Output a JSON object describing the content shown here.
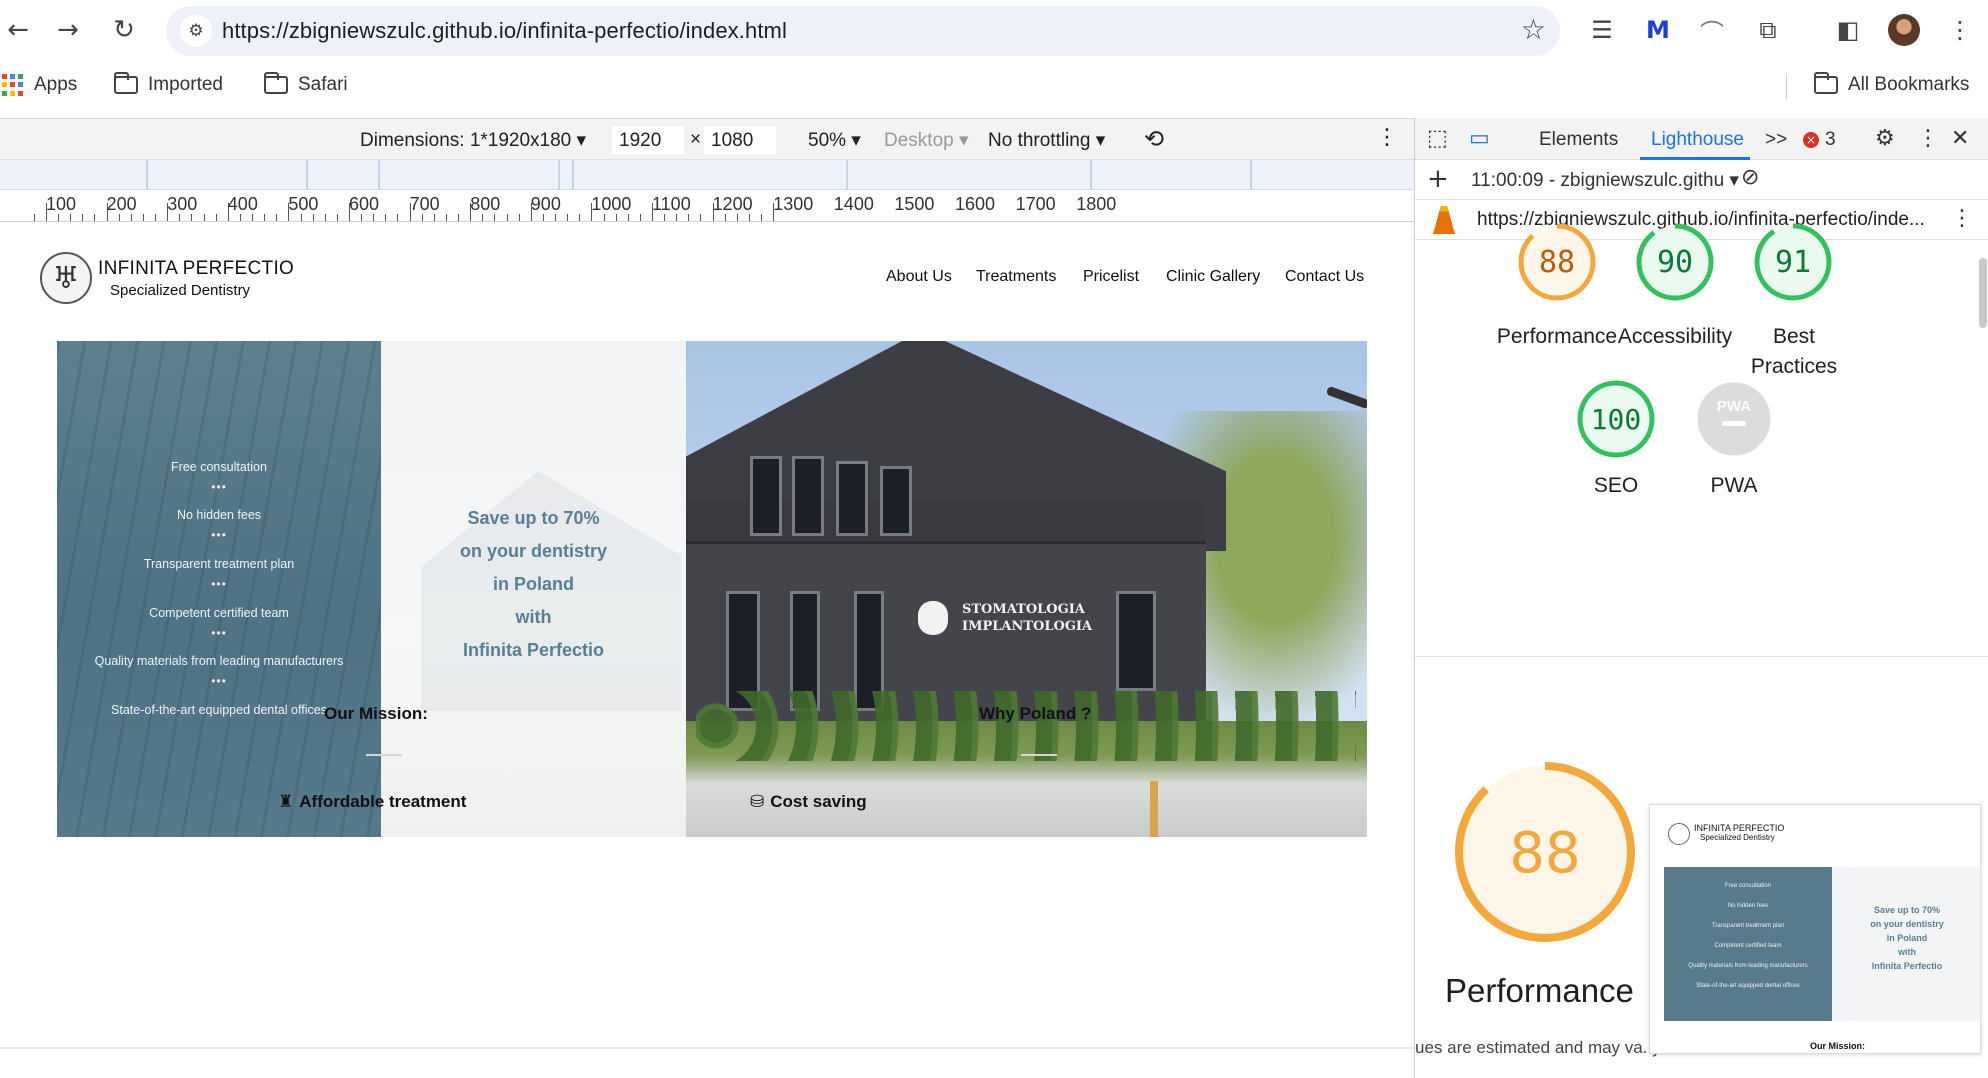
{
  "browser": {
    "url": "https://zbigniewszulc.github.io/infinita-perfectio/index.html",
    "bookmarks": [
      "Apps",
      "Imported",
      "Safari"
    ],
    "all_bookmarks": "All Bookmarks"
  },
  "device_toolbar": {
    "dimensions_label": "Dimensions: 1*1920x180",
    "width": "1920",
    "times": "×",
    "height": "1080",
    "zoom": "50%",
    "device_mode": "Desktop",
    "throttling": "No throttling"
  },
  "ruler": [
    "100",
    "200",
    "300",
    "400",
    "500",
    "600",
    "700",
    "800",
    "900",
    "1000",
    "1100",
    "1200",
    "1300",
    "1400",
    "1500",
    "1600",
    "1700",
    "1800"
  ],
  "site": {
    "brand_name": "INFINITA PERFECTIO",
    "brand_sub": "Specialized Dentistry",
    "nav": [
      "About Us",
      "Treatments",
      "Pricelist",
      "Clinic Gallery",
      "Contact Us"
    ],
    "features": [
      "Free consultation",
      "No hidden fees",
      "Transparent treatment plan",
      "Competent certified team",
      "Quality materials from leading manufacturers",
      "State-of-the-art equipped dental offices"
    ],
    "separator": "•••",
    "save_lines": [
      "Save up to 70%",
      "on your dentistry",
      "in Poland",
      "with",
      "Infinita Perfectio"
    ],
    "photo_sign": [
      "STOMATOLOGIA",
      "IMPLANTOLOGIA"
    ],
    "mission_title": "Our Mission:",
    "why_title": "Why Poland ?",
    "affordable": "Affordable treatment",
    "cost_saving": "Cost saving"
  },
  "devtools": {
    "tabs": [
      "Elements",
      "Lighthouse"
    ],
    "more_tabs": ">>",
    "error_count": "3",
    "report_time": "11:00:09 - zbigniewszulc.githu",
    "report_url": "https://zbigniewszulc.github.io/infinita-perfectio/inde...",
    "scores": [
      {
        "label": "Performance",
        "value": "88",
        "score": 88,
        "color": "#f4a83a",
        "bg": "#fff6ea"
      },
      {
        "label": "Accessibility",
        "value": "90",
        "score": 90,
        "color": "#33c15f",
        "bg": "#eafaf0"
      },
      {
        "label": "Best Practices",
        "value": "91",
        "score": 91,
        "color": "#33c15f",
        "bg": "#eafaf0"
      },
      {
        "label": "SEO",
        "value": "100",
        "score": 100,
        "color": "#33c15f",
        "bg": "#eafaf0"
      },
      {
        "label": "PWA",
        "value": "PWA",
        "score": 0,
        "color": "#cfcfcf",
        "bg": "#dcdcdc"
      }
    ],
    "big_score": "88",
    "big_label": "Performance",
    "footnote": "ues are estimated and may va. y. The",
    "thumb": {
      "brand": "INFINITA PERFECTIO",
      "sub": "Specialized Dentistry",
      "mission": "Our Mission:"
    }
  },
  "colors": {
    "accent": "#1a73e8",
    "hero_blue": "#4f7383",
    "save_text": "#5a7f93",
    "orange": "#f4a83a",
    "green": "#33c15f"
  }
}
